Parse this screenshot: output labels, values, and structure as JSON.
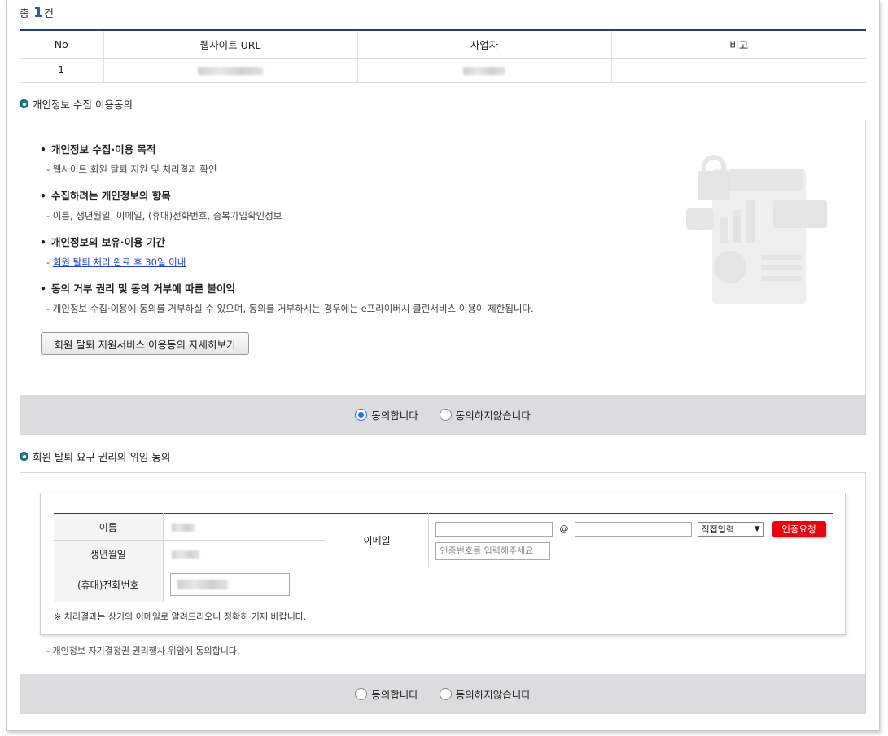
{
  "summary": {
    "prefix": "총",
    "count": "1",
    "suffix": "건"
  },
  "url_table": {
    "headers": [
      "No",
      "웹사이트 URL",
      "사업자",
      "비고"
    ],
    "rows": [
      {
        "no": "1",
        "url": "",
        "business": "",
        "note": ""
      }
    ]
  },
  "privacy_section": {
    "title": "개인정보 수집 이용동의",
    "items": [
      {
        "heading": "개인정보 수집·이용 목적",
        "desc": "- 웹사이트 회원 탈퇴 지원 및 처리결과 확인"
      },
      {
        "heading": "수집하려는 개인정보의 항목",
        "desc": "- 이름, 생년월일, 이메일, (휴대)전화번호, 중복가입확인정보"
      },
      {
        "heading": "개인정보의 보유·이용 기간",
        "desc_prefix": "- ",
        "desc_link": "회원 탈퇴 처리 완료 후 30일 이내"
      },
      {
        "heading": "동의 거부 권리 및 동의 거부에 따른 불이익",
        "desc": "- 개인정보 수집·이용에 동의를 거부하실 수 있으며, 동의를 거부하시는 경우에는 e프라이버시 클린서비스 이용이 제한됩니다."
      }
    ],
    "detail_button": "회원 탈퇴 지원서비스 이용동의 자세히보기",
    "agree_label": "동의합니다",
    "disagree_label": "동의하지않습니다",
    "selected": "agree"
  },
  "delegation_section": {
    "title": "회원 탈퇴 요구 권리의 위임 동의",
    "form": {
      "name_label": "이름",
      "birth_label": "생년월일",
      "phone_label": "(휴대)전화번호",
      "email_label": "이메일",
      "at_sign": "@",
      "domain_select": "직접입력",
      "verify_button": "인증요청",
      "code_placeholder": "인증번호를 입력해주세요",
      "note": "※ 처리결과는 상기의 이메일로 알려드리오니 정확히 기재 바랍니다."
    },
    "desc": "- 개인정보 자기결정권 권리행사 위임에 동의합니다.",
    "agree_label": "동의합니다",
    "disagree_label": "동의하지않습니다",
    "selected": "none"
  },
  "colors": {
    "accent": "#1f3f75",
    "count": "#1f5fae",
    "verify_button": "#e8050f",
    "consent_bar": "#dcdcdf"
  }
}
